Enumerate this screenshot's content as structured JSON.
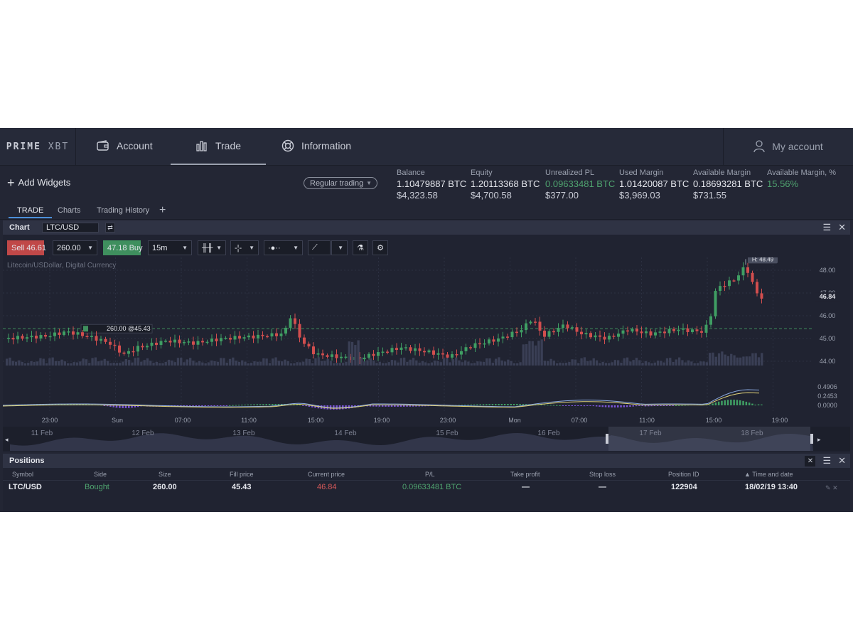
{
  "nav": {
    "logo_a": "PRIME",
    "logo_b": "XBT",
    "account": "Account",
    "trade": "Trade",
    "information": "Information",
    "my_account": "My account",
    "icons": [
      "wallet-icon",
      "bar-chart-icon",
      "lifebuoy-icon",
      "user-icon"
    ]
  },
  "toolbar": {
    "add_widgets": "Add Widgets",
    "mode_select": "Regular trading"
  },
  "stats": [
    {
      "label": "Balance",
      "value": "1.10479887 BTC",
      "usd": "$4,323.58"
    },
    {
      "label": "Equity",
      "value": "1.20113368 BTC",
      "usd": "$4,700.58"
    },
    {
      "label": "Unrealized PL",
      "value": "0.09633481 BTC",
      "usd": "$377.00"
    },
    {
      "label": "Used Margin",
      "value": "1.01420087 BTC",
      "usd": "$3,969.03"
    },
    {
      "label": "Available Margin",
      "value": "0.18693281 BTC",
      "usd": "$731.55"
    },
    {
      "label": "Available Margin, %",
      "value": "15.56%",
      "usd": ""
    }
  ],
  "subtabs": [
    "TRADE",
    "Charts",
    "Trading History"
  ],
  "chart_panel": {
    "title": "Chart",
    "symbol": "LTC/USD",
    "sell_label": "Sell",
    "sell_price": "46.61",
    "quantity": "260.00",
    "buy_price": "47.18",
    "buy_label": "Buy",
    "interval": "15m",
    "instrument_desc": "Litecoin/USDollar, Digital Currency",
    "order_line_label": "260.00 @45.43",
    "high_label": "H: 48.49"
  },
  "chart_data": {
    "type": "candlestick",
    "price_ticks": [
      "48.00",
      "47.00",
      "46.00",
      "45.00",
      "44.00"
    ],
    "current_price_label": "46.84",
    "macd_ticks": [
      "0.4906",
      "0.2453",
      "0.0000"
    ],
    "time_ticks": [
      "23:00",
      "Sun",
      "07:00",
      "11:00",
      "15:00",
      "19:00",
      "23:00",
      "Mon",
      "07:00",
      "11:00",
      "15:00",
      "19:00"
    ],
    "navigator_ticks": [
      "11 Feb",
      "12 Feb",
      "13 Feb",
      "14 Feb",
      "15 Feb",
      "16 Feb",
      "17 Feb",
      "18 Feb"
    ],
    "order_price": 45.43,
    "high": 48.49,
    "ylim": [
      43.4,
      48.6
    ],
    "colors": {
      "up": "#3f9e63",
      "down": "#d24e4e",
      "order_line": "#3f8f5e"
    }
  },
  "positions": {
    "title": "Positions",
    "headers": [
      "Symbol",
      "Side",
      "Size",
      "Fill price",
      "Current price",
      "P/L",
      "Take profit",
      "Stop loss",
      "Position ID",
      "Time and date"
    ],
    "row": {
      "symbol": "LTC/USD",
      "side": "Bought",
      "size": "260.00",
      "fill_price": "45.43",
      "current_price": "46.84",
      "pl": "0.09633481 BTC",
      "take_profit": "—",
      "stop_loss": "—",
      "position_id": "122904",
      "time": "18/02/19 13:40"
    }
  }
}
